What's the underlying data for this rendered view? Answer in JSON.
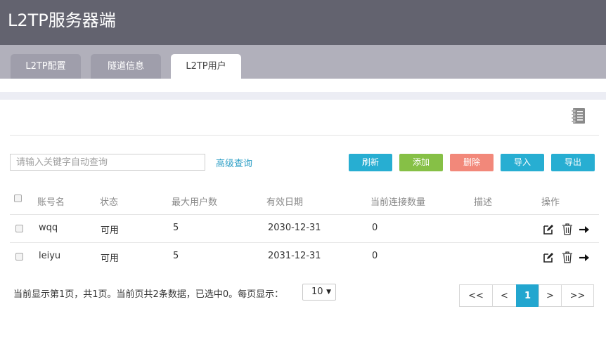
{
  "header": {
    "title": "L2TP服务器端"
  },
  "tabs": [
    {
      "label": "L2TP配置",
      "active": false
    },
    {
      "label": "隧道信息",
      "active": false
    },
    {
      "label": "L2TP用户",
      "active": true
    }
  ],
  "toolbar": {
    "search_placeholder": "请输入关键字自动查询",
    "advanced_search": "高级查询",
    "buttons": {
      "refresh": "刷新",
      "add": "添加",
      "delete": "删除",
      "import": "导入",
      "export": "导出"
    }
  },
  "colors": {
    "refresh": "#27aed2",
    "add": "#86c046",
    "delete": "#f2887a",
    "import": "#27aed2",
    "export": "#27aed2",
    "accent": "#22a6cf"
  },
  "table": {
    "headers": [
      "账号名",
      "状态",
      "最大用户数",
      "有效日期",
      "当前连接数量",
      "描述",
      "操作"
    ],
    "rows": [
      {
        "account": "wqq",
        "status": "可用",
        "max_users": "5",
        "expiry": "2030-12-31",
        "connections": "0",
        "description": ""
      },
      {
        "account": "leiyu",
        "status": "可用",
        "max_users": "5",
        "expiry": "2031-12-31",
        "connections": "0",
        "description": ""
      }
    ]
  },
  "footer": {
    "summary": "当前显示第1页，共1页。当前页共2条数据，已选中0。每页显示：",
    "page_size": "10",
    "pager": {
      "first": "<<",
      "prev": "<",
      "current": "1",
      "next": ">",
      "last": ">>"
    }
  }
}
